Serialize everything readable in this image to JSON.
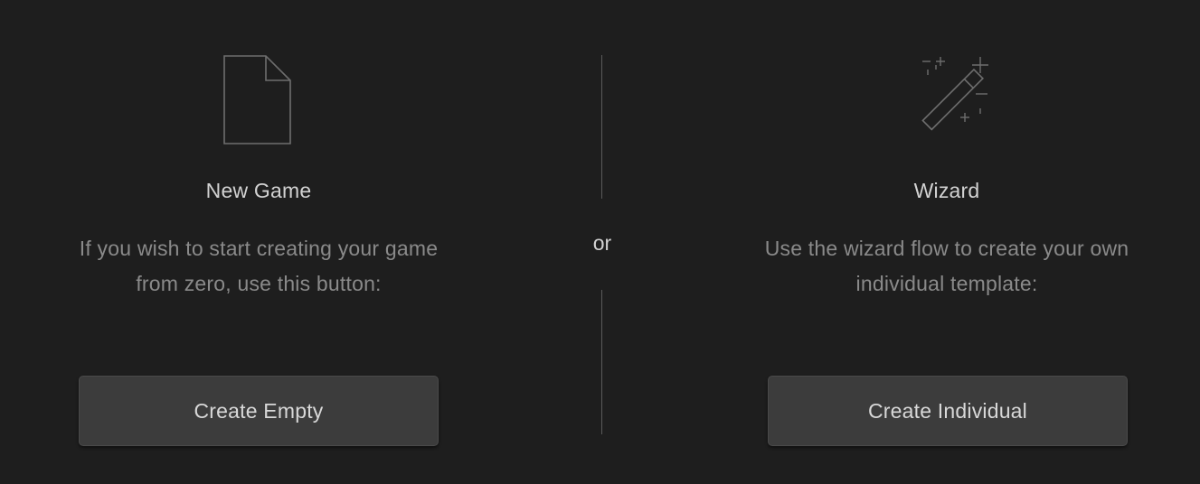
{
  "new_game": {
    "icon": "document-icon",
    "title": "New Game",
    "description_line1": "If you wish to start creating your game",
    "description_line2": "from zero, use this button:",
    "button_label": "Create Empty"
  },
  "divider": {
    "label": "or"
  },
  "wizard": {
    "icon": "magic-wand-icon",
    "title": "Wizard",
    "description_line1": "Use the wizard flow to create your own",
    "description_line2": "individual template:",
    "button_label": "Create Individual"
  },
  "colors": {
    "background": "#1e1e1e",
    "button": "#3c3c3c",
    "title_text": "#d2d2d2",
    "description_text": "#8a8a8a",
    "icon_stroke": "#6e6e6e"
  }
}
